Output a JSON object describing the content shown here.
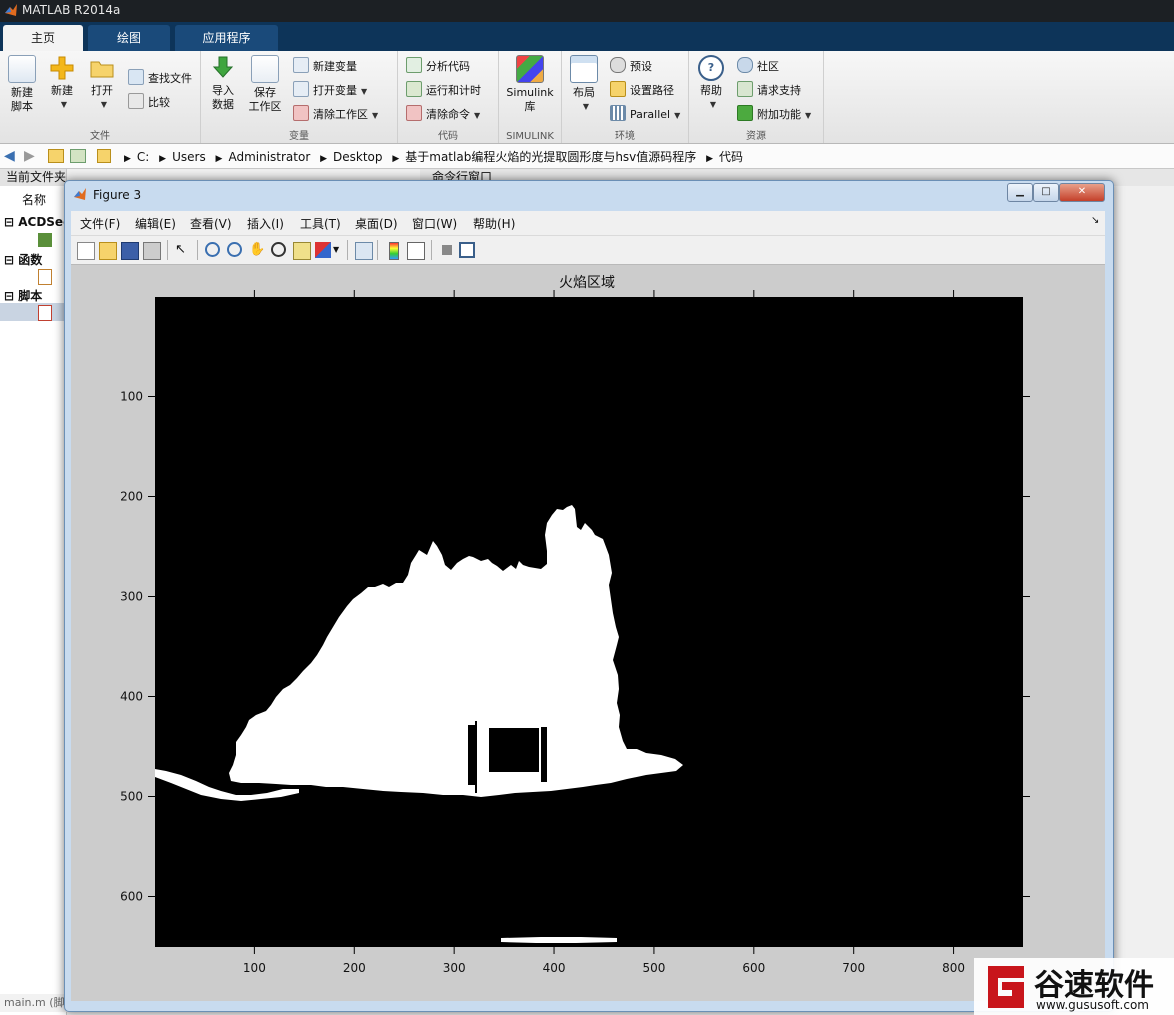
{
  "window": {
    "title": "MATLAB R2014a"
  },
  "ribbon_tabs": [
    {
      "label": "主页",
      "active": true
    },
    {
      "label": "绘图",
      "active": false
    },
    {
      "label": "应用程序",
      "active": false
    }
  ],
  "ribbon": {
    "file": {
      "label": "文件",
      "new_script": [
        "新建",
        "脚本"
      ],
      "new": "新建",
      "open": "打开",
      "find_files": "查找文件",
      "compare": "比较"
    },
    "variable": {
      "label": "变量",
      "import_data": [
        "导入",
        "数据"
      ],
      "save_workspace": [
        "保存",
        "工作区"
      ],
      "new_variable": "新建变量",
      "open_variable": "打开变量",
      "clear_workspace": "清除工作区"
    },
    "code": {
      "label": "代码",
      "analyze_code": "分析代码",
      "run_and_time": "运行和计时",
      "clear_commands": "清除命令"
    },
    "simulink": {
      "label": "SIMULINK",
      "library": [
        "Simulink",
        "库"
      ]
    },
    "environment": {
      "label": "环境",
      "layout": "布局",
      "preferences": "预设",
      "set_path": "设置路径",
      "parallel": "Parallel"
    },
    "resources": {
      "label": "资源",
      "help": "帮助",
      "community": "社区",
      "request_support": "请求支持",
      "addons": "附加功能"
    }
  },
  "address": {
    "crumbs": [
      "C:",
      "Users",
      "Administrator",
      "Desktop",
      "基于matlab编程火焰的光提取圆形度与hsv值源码程序",
      "代码"
    ]
  },
  "left_panel": {
    "header": "当前文件夹",
    "column": "名称",
    "groups": [
      "ACDSee",
      "函数",
      "脚本"
    ],
    "status": "main.m (脚"
  },
  "command_window": {
    "header": "命令行窗口"
  },
  "figure": {
    "title": "Figure 3",
    "menus": [
      "文件(F)",
      "编辑(E)",
      "查看(V)",
      "插入(I)",
      "工具(T)",
      "桌面(D)",
      "窗口(W)",
      "帮助(H)"
    ],
    "toolbar_icons": [
      "new-figure-icon",
      "open-icon",
      "save-icon",
      "print-icon",
      "pointer-icon",
      "zoom-in-icon",
      "zoom-out-icon",
      "pan-icon",
      "rotate-icon",
      "data-cursor-icon",
      "brush-icon",
      "link-icon",
      "colorbar-icon",
      "legend-icon",
      "hide-tools-icon",
      "show-tools-icon"
    ]
  },
  "chart_data": {
    "type": "image",
    "title": "火焰区域",
    "x_ticks": [
      100,
      200,
      300,
      400,
      500,
      600,
      700,
      800
    ],
    "y_ticks": [
      100,
      200,
      300,
      400,
      500,
      600
    ],
    "xlim": [
      0.5,
      869.5
    ],
    "ylim": [
      0.5,
      650.5
    ],
    "y_reversed": true,
    "colormap": [
      "#000000",
      "#ffffff"
    ]
  },
  "watermark": {
    "brand": "谷速软件",
    "url": "www.gususoft.com"
  }
}
